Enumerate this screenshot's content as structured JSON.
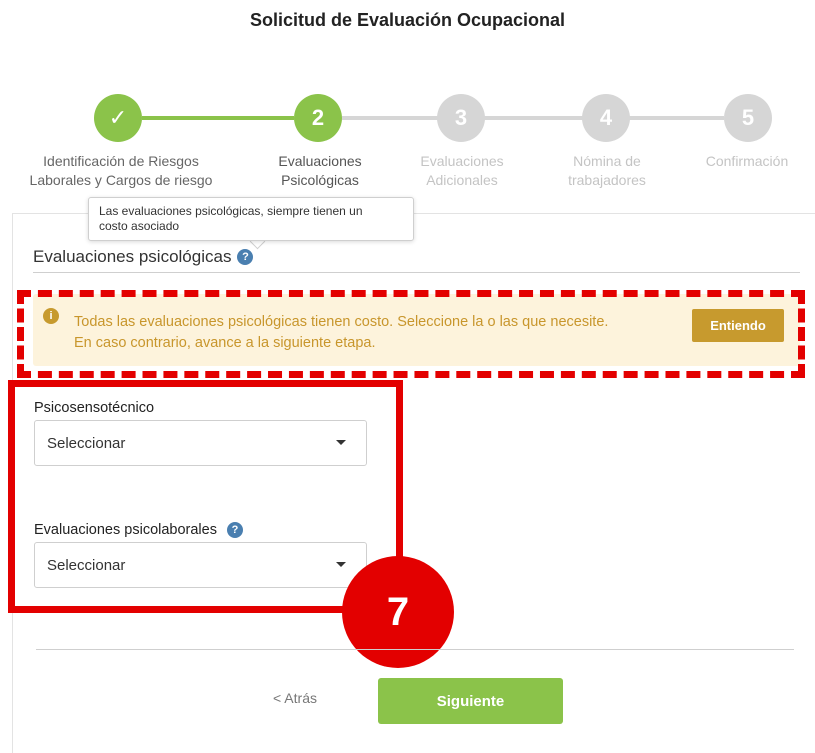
{
  "page_title": "Solicitud de Evaluación Ocupacional",
  "stepper": {
    "steps": [
      {
        "number": "✓",
        "label_line1": "Identificación de Riesgos",
        "label_line2": "Laborales y Cargos de riesgo",
        "state": "completed"
      },
      {
        "number": "2",
        "label_line1": "Evaluaciones",
        "label_line2": "Psicológicas",
        "state": "active"
      },
      {
        "number": "3",
        "label_line1": "Evaluaciones",
        "label_line2": "Adicionales",
        "state": "pending"
      },
      {
        "number": "4",
        "label_line1": "Nómina de",
        "label_line2": "trabajadores",
        "state": "pending"
      },
      {
        "number": "5",
        "label_line1": "Confirmación",
        "label_line2": "",
        "state": "pending"
      }
    ]
  },
  "tooltip": {
    "line1": "Las evaluaciones psicológicas, siempre tienen un",
    "line2": "costo asociado"
  },
  "section": {
    "title": "Evaluaciones psicológicas",
    "help_glyph": "?"
  },
  "alert": {
    "icon_glyph": "i",
    "line1": "Todas las evaluaciones psicológicas tienen costo. Seleccione la o las que necesite.",
    "line2": "En caso contrario, avance a la siguiente etapa.",
    "button_label": "Entiendo"
  },
  "fields": {
    "psicosensotecnico": {
      "label": "Psicosensotécnico",
      "value": "Seleccionar"
    },
    "psicolaborales": {
      "label": "Evaluaciones psicolaborales",
      "help_glyph": "?",
      "value": "Seleccionar"
    }
  },
  "annotation": {
    "badge_number": "7"
  },
  "footer": {
    "back_label": "< Atrás",
    "next_label": "Siguiente"
  },
  "colors": {
    "primary_green": "#8bc34a",
    "pending_gray": "#d6d6d6",
    "warning_bg": "#fdf3dc",
    "warning_text": "#c8962c",
    "annotation_red": "#e30000"
  }
}
